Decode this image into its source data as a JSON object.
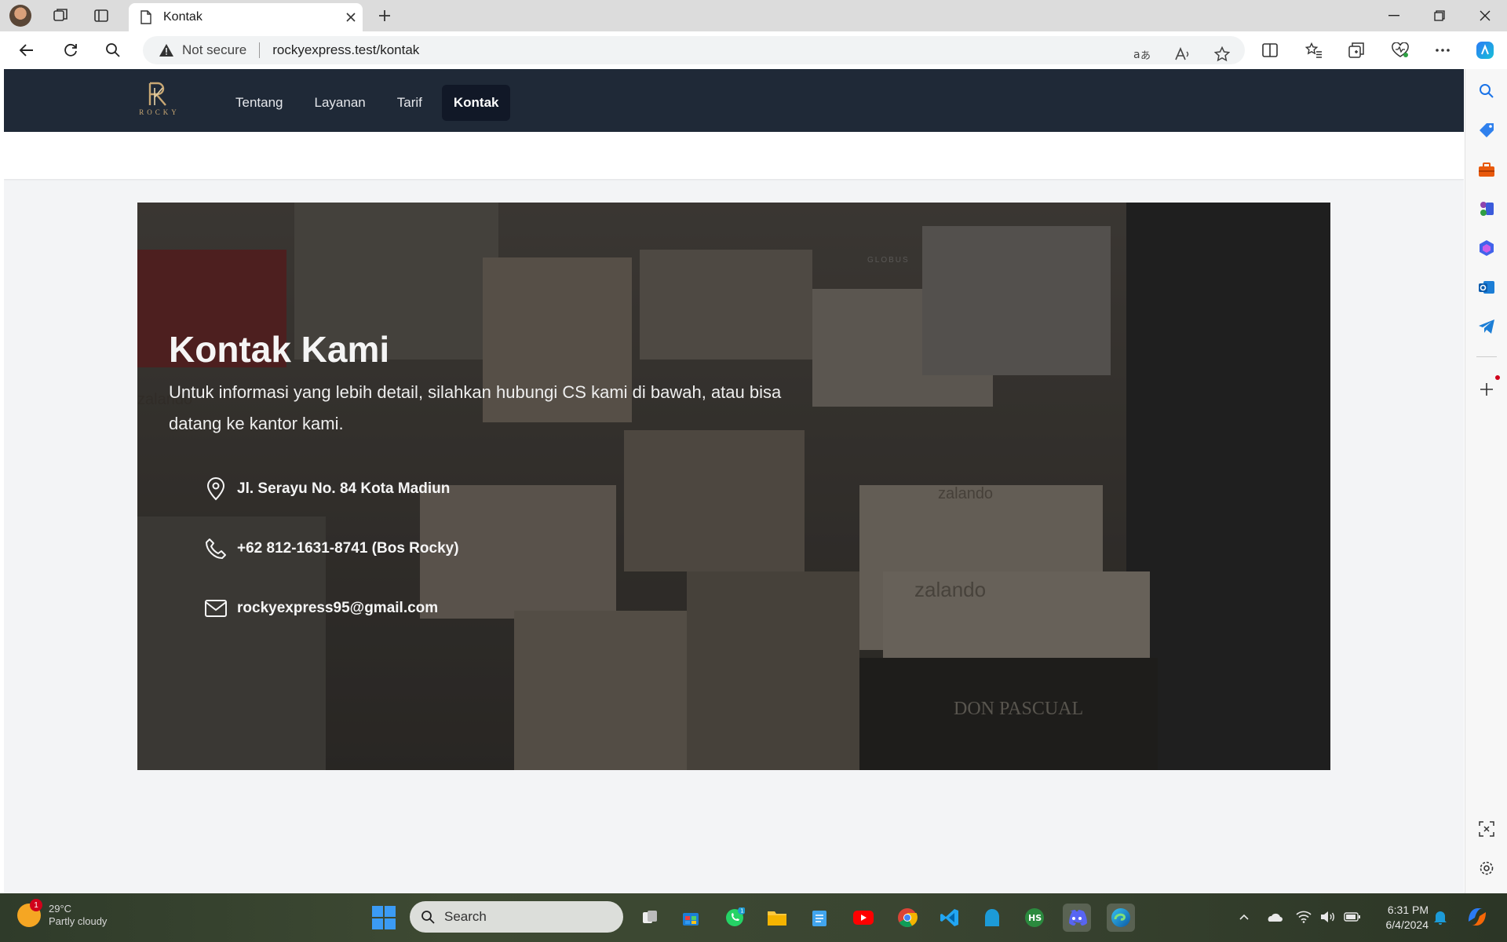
{
  "browser": {
    "tab_title": "Kontak",
    "security_label": "Not secure",
    "url": "rockyexpress.test/kontak"
  },
  "site": {
    "logo_text": "ROCKY",
    "nav": [
      "Tentang",
      "Layanan",
      "Tarif",
      "Kontak"
    ],
    "active_nav": "Kontak"
  },
  "hero": {
    "title": "Kontak Kami",
    "description": "Untuk informasi yang lebih detail, silahkan hubungi CS kami di bawah, atau bisa datang ke kantor kami.",
    "address": "Jl. Serayu No. 84 Kota Madiun",
    "phone": "+62 812-1631-8741 (Bos Rocky)",
    "email": "rockyexpress95@gmail.com",
    "photo_labels": [
      "zalando",
      "zalando",
      "zalando",
      "DON PASCUAL",
      "GLOBUS"
    ]
  },
  "taskbar": {
    "weather_temp": "29°C",
    "weather_desc": "Partly cloudy",
    "weather_badge": "1",
    "search_label": "Search",
    "whatsapp_badge": "1",
    "time": "6:31 PM",
    "date": "6/4/2024"
  },
  "colors": {
    "nav_bg": "#1f2937",
    "nav_active_bg": "#111827",
    "logo_gold": "#c9a874"
  }
}
